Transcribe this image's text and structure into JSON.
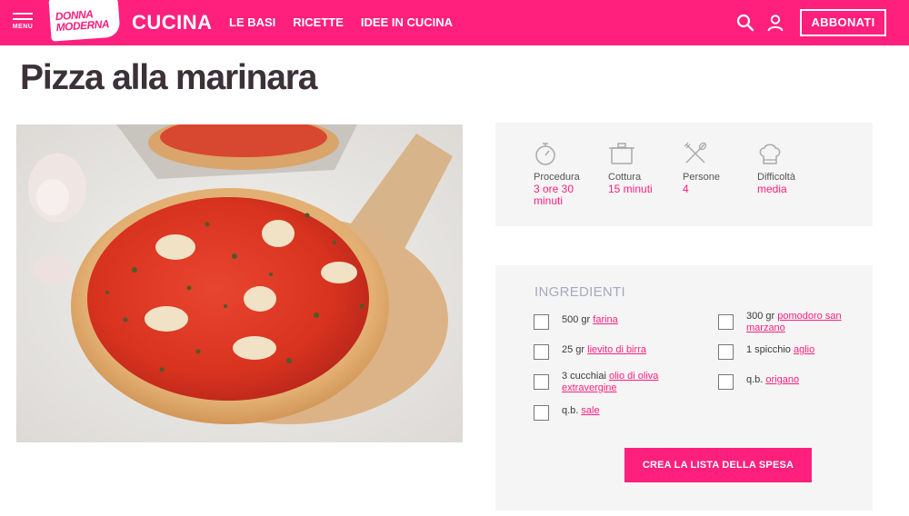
{
  "header": {
    "menu_label": "MENU",
    "logo_line1": "DONNA",
    "logo_line2": "MODERNA",
    "section_title": "CUCINA",
    "nav": [
      "LE BASI",
      "RICETTE",
      "IDEE IN CUCINA"
    ],
    "subscribe_label": "ABBONATI",
    "brand_color": "#ff1f7c"
  },
  "page": {
    "title": "Pizza alla marinara"
  },
  "recipe_info": [
    {
      "icon": "stopwatch-icon",
      "label": "Procedura",
      "value": "3 ore 30 minuti"
    },
    {
      "icon": "pot-icon",
      "label": "Cottura",
      "value": "15 minuti"
    },
    {
      "icon": "cutlery-icon",
      "label": "Persone",
      "value": "4"
    },
    {
      "icon": "chef-hat-icon",
      "label": "Difficoltà",
      "value": "media"
    }
  ],
  "ingredients": {
    "title": "INGREDIENTI",
    "items": [
      {
        "qty": "500 gr",
        "name": "farina"
      },
      {
        "qty": "300 gr",
        "name": "pomodoro san marzano"
      },
      {
        "qty": "25 gr",
        "name": "lievito di birra"
      },
      {
        "qty": "1 spicchio",
        "name": "aglio"
      },
      {
        "qty": "3 cucchiai",
        "name": "olio di oliva extravergine"
      },
      {
        "qty": "q.b.",
        "name": "origano"
      },
      {
        "qty": "q.b.",
        "name": "sale"
      }
    ],
    "cta_label": "CREA LA LISTA DELLA SPESA"
  }
}
